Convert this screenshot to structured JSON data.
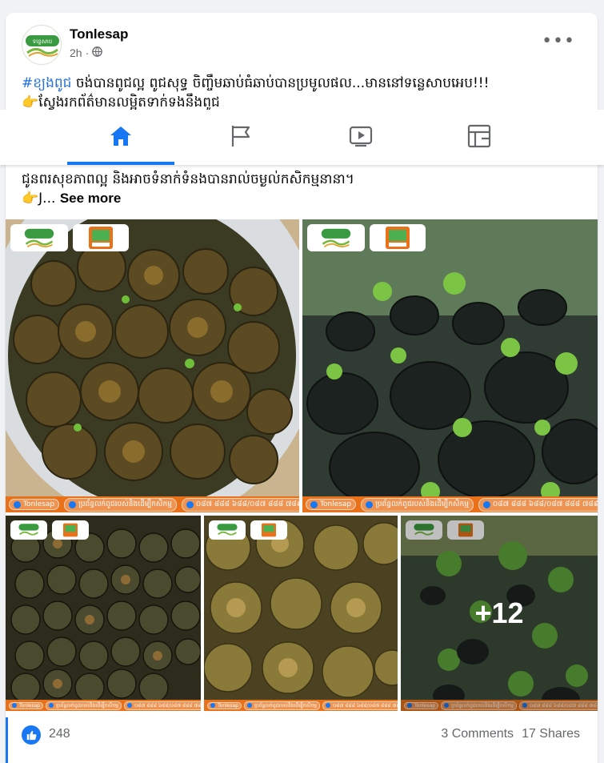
{
  "post": {
    "page_name": "Tonlesap",
    "time": "2h",
    "privacy_icon": "globe-icon",
    "more_label": "•••",
    "hashtag": "#ខ្យងពូជ",
    "line1_rest": " ចង់បានពូជល្អ ពូជសុទ្ធ ចិញ្ចឹមឆាប់ធំឆាប់បានប្រមូលផល...មាននៅទន្លេសាបអេប!!!",
    "line2": "ស្វែងរកព័ត៌មានលម្អិតទាក់ទងនឹងពូជ",
    "line3": "ជូនពរសុខភាពល្អ និងអាចទំនាក់ទំនងបានរាល់ចម្ងល់កសិកម្មនានា។",
    "line4_prefix": "J... ",
    "see_more": "See more",
    "hand_emoji": "👉"
  },
  "tabs": [
    {
      "name": "home",
      "icon": "home-icon",
      "active": true
    },
    {
      "name": "pages",
      "icon": "flag-icon",
      "active": false
    },
    {
      "name": "watch",
      "icon": "video-play-icon",
      "active": false
    },
    {
      "name": "gaming",
      "icon": "gaming-icon",
      "active": false
    }
  ],
  "photos": {
    "watermark_brand": "Tonlesap",
    "watermark_channel": "ប្រព័ន្ធលក់ពូជរបស់និងដើម្បីកសិកម្ម",
    "watermark_phone": "០៨៧ ៨៨៨ ៦៨៨/០៨៧ ៨៨៨ ៧៨៩",
    "more_count": "+12"
  },
  "stats": {
    "reactions": "248",
    "comments": "3 Comments",
    "shares": "17 Shares"
  },
  "colors": {
    "accent": "#1877f2",
    "hashtag": "#216fdb",
    "watermark_bar": "#e8711a"
  }
}
